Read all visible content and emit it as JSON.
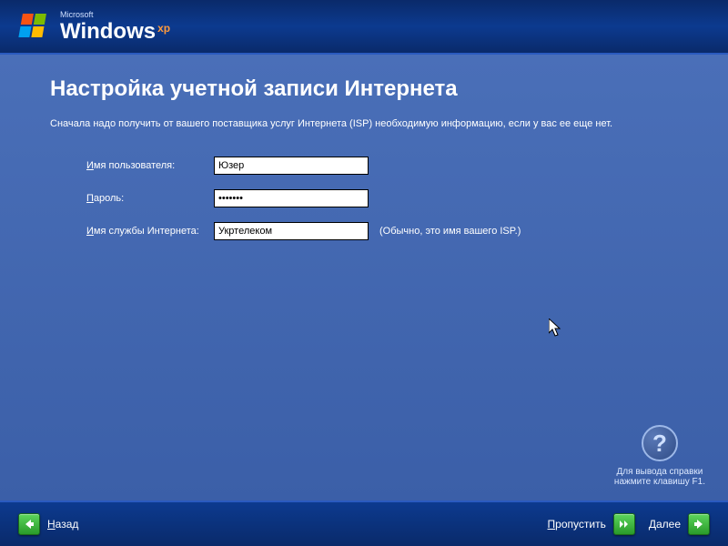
{
  "header": {
    "ms": "Microsoft",
    "product": "Windows",
    "edition": "xp"
  },
  "page": {
    "title": "Настройка учетной записи Интернета",
    "subtitle": "Сначала надо получить от вашего поставщика услуг Интернета (ISP) необходимую информацию, если у вас ее еще нет."
  },
  "form": {
    "username": {
      "label_pre": "И",
      "label_rest": "мя пользователя:",
      "value": "Юзер"
    },
    "password": {
      "label_pre": "П",
      "label_rest": "ароль:",
      "value": "•••••••"
    },
    "isp": {
      "label_pre": "И",
      "label_rest": "мя службы Интернета:",
      "value": "Укртелеком",
      "hint": "(Обычно, это имя вашего ISP.)"
    }
  },
  "help": {
    "line1": "Для вывода справки",
    "line2": "нажмите клавишу F1."
  },
  "footer": {
    "back": {
      "u": "Н",
      "rest": "азад"
    },
    "skip": {
      "u": "П",
      "rest": "ропустить"
    },
    "next": {
      "u": "Д",
      "rest": "алее"
    }
  }
}
